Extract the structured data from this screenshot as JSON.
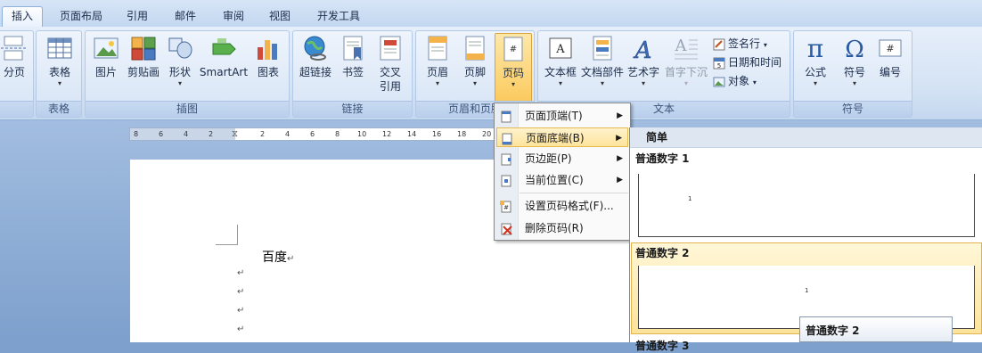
{
  "tabs": [
    "插入",
    "页面布局",
    "引用",
    "邮件",
    "审阅",
    "视图",
    "开发工具"
  ],
  "ribbon": {
    "groups": {
      "pages": {
        "label": "",
        "buttons": {
          "page_break": "分页"
        }
      },
      "table": {
        "label": "表格",
        "buttons": {
          "table": "表格"
        }
      },
      "illustrations": {
        "label": "插图",
        "buttons": {
          "picture": "图片",
          "clipart": "剪贴画",
          "shapes": "形状",
          "smartart": "SmartArt",
          "chart": "图表"
        }
      },
      "links": {
        "label": "链接",
        "buttons": {
          "hyperlink": "超链接",
          "bookmark": "书签",
          "cross_ref_line1": "交叉",
          "cross_ref_line2": "引用"
        }
      },
      "header_footer": {
        "label": "页眉和页脚",
        "buttons": {
          "header": "页眉",
          "footer": "页脚",
          "page_number": "页码"
        }
      },
      "text": {
        "label": "文本",
        "buttons": {
          "textbox": "文本框",
          "quickparts": "文档部件",
          "wordart": "艺术字",
          "dropcap": "首字下沉",
          "signature": "签名行",
          "datetime": "日期和时间",
          "object": "对象"
        }
      },
      "symbols": {
        "label": "符号",
        "buttons": {
          "equation": "公式",
          "symbol": "符号",
          "numbering": "编号"
        }
      }
    }
  },
  "ruler": {
    "ticks": [
      "8",
      "6",
      "4",
      "2",
      "2",
      "4",
      "6",
      "8",
      "10",
      "12",
      "14",
      "16",
      "18",
      "20"
    ]
  },
  "document": {
    "text": "百度"
  },
  "page_number_menu": {
    "items": [
      {
        "label": "页面顶端(T)",
        "has_submenu": true
      },
      {
        "label": "页面底端(B)",
        "has_submenu": true
      },
      {
        "label": "页边距(P)",
        "has_submenu": true
      },
      {
        "label": "当前位置(C)",
        "has_submenu": true
      },
      {
        "label": "设置页码格式(F)...",
        "has_submenu": false
      },
      {
        "label": "删除页码(R)",
        "has_submenu": false
      }
    ]
  },
  "gallery": {
    "header": "简单",
    "sections": [
      "普通数字 1",
      "普通数字 2",
      "普通数字 3"
    ],
    "thumb_number": "1"
  },
  "tooltip": "普通数字 2",
  "colors": {
    "accent": "#fbc95c",
    "ribbon": "#d3e2f4",
    "tab_text": "#1b2c4a"
  }
}
